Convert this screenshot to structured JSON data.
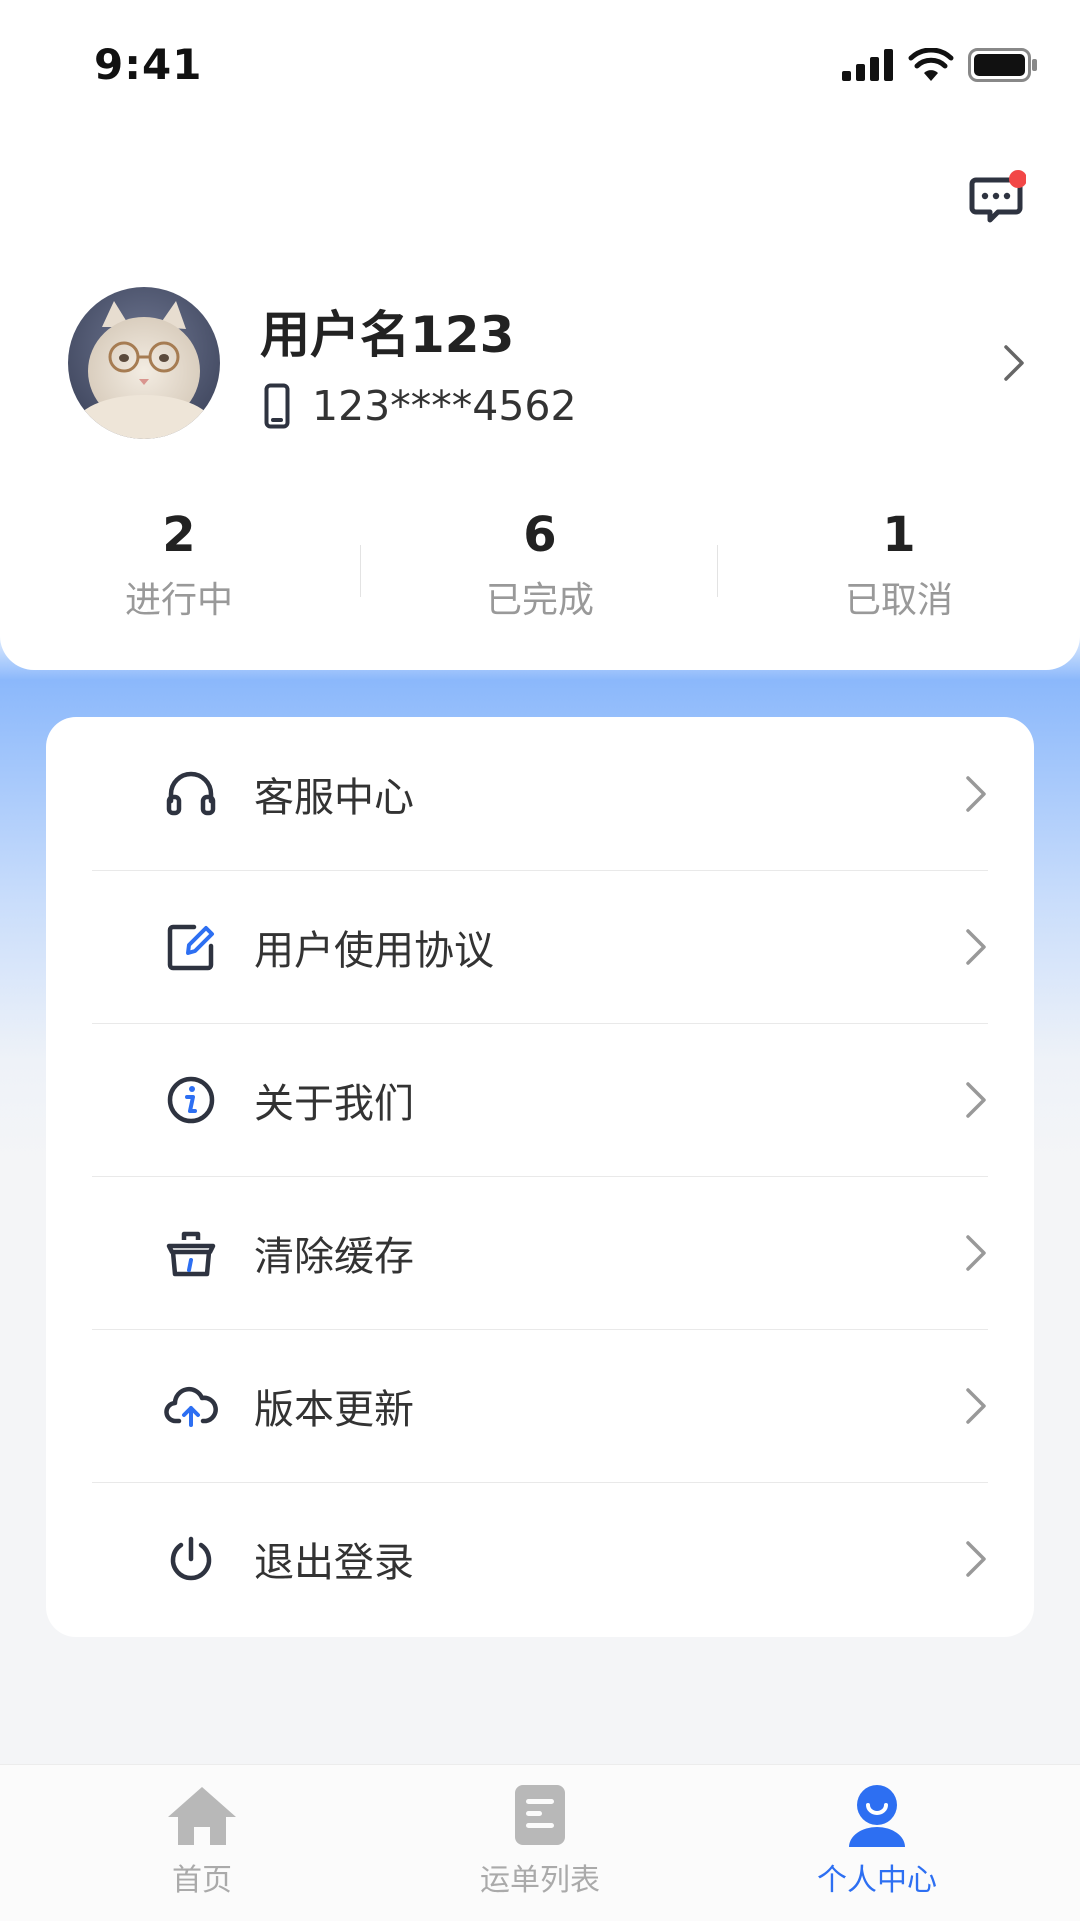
{
  "status_bar": {
    "time": "9:41"
  },
  "profile": {
    "username": "用户名123",
    "phone": "123****4562"
  },
  "stats": [
    {
      "value": "2",
      "label": "进行中"
    },
    {
      "value": "6",
      "label": "已完成"
    },
    {
      "value": "1",
      "label": "已取消"
    }
  ],
  "menu": [
    {
      "label": "客服中心",
      "icon": "headset-icon"
    },
    {
      "label": "用户使用协议",
      "icon": "agreement-edit-icon"
    },
    {
      "label": "关于我们",
      "icon": "info-icon"
    },
    {
      "label": "清除缓存",
      "icon": "basket-clean-icon"
    },
    {
      "label": "版本更新",
      "icon": "cloud-upload-icon"
    },
    {
      "label": "退出登录",
      "icon": "power-icon"
    }
  ],
  "tabbar": [
    {
      "label": "首页",
      "icon": "home-icon",
      "active": false
    },
    {
      "label": "运单列表",
      "icon": "document-list-icon",
      "active": false
    },
    {
      "label": "个人中心",
      "icon": "user-icon",
      "active": true
    }
  ],
  "colors": {
    "accent": "#2d6ff2",
    "badge": "#f24747",
    "icon_dark": "#2e3340"
  }
}
